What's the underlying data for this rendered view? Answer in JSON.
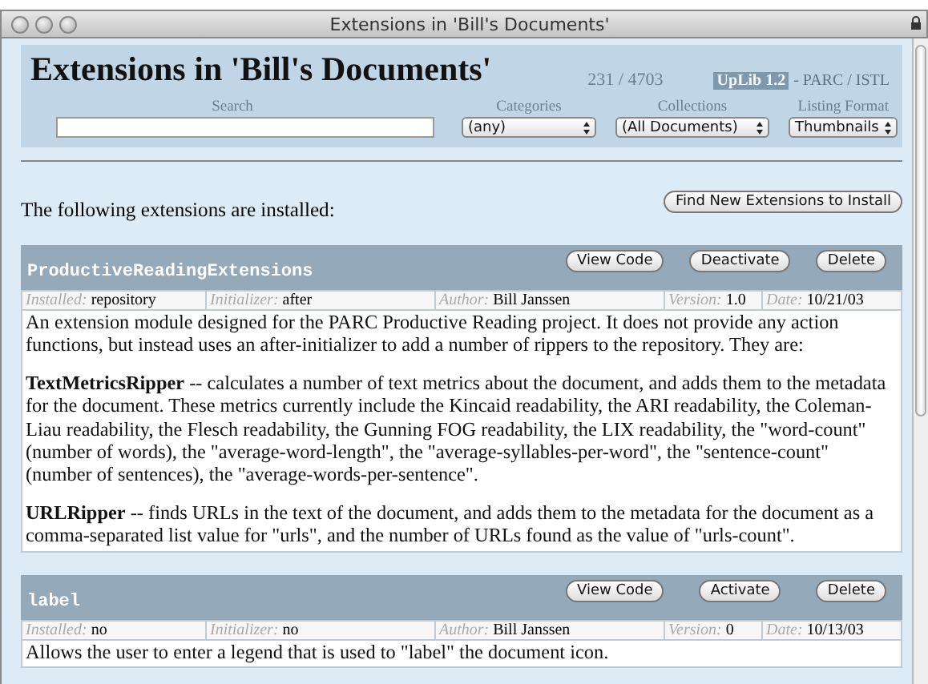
{
  "window": {
    "title": "Extensions in 'Bill's Documents'"
  },
  "header": {
    "title": "Extensions in 'Bill's Documents'",
    "count": "231 / 4703",
    "brand": "UpLib 1.2",
    "brand_suffix": "- PARC / ISTL",
    "search": {
      "label": "Search"
    },
    "dropdowns": [
      {
        "label": "Categories",
        "value": "(any)"
      },
      {
        "label": "Collections",
        "value": "(All Documents)"
      },
      {
        "label": "Listing Format",
        "value": "Thumbnails"
      }
    ]
  },
  "intro": "The following extensions are installed:",
  "find_button": "Find New Extensions to Install",
  "extensions": [
    {
      "name": "ProductiveReadingExtensions",
      "buttons": [
        "View Code",
        "Deactivate",
        "Delete"
      ],
      "meta": [
        {
          "label": "Installed:",
          "value": "repository"
        },
        {
          "label": "Initializer:",
          "value": "after"
        },
        {
          "label": "Author:",
          "value": "Bill Janssen"
        },
        {
          "label": "Version:",
          "value": "1.0"
        },
        {
          "label": "Date:",
          "value": "10/21/03"
        }
      ],
      "paragraphs": [
        "An extension module designed for the PARC Productive Reading project. It does not provide any action functions, but instead uses an after-initializer to add a number of rippers to the repository. They are:",
        "**TextMetricsRipper** -- calculates a number of text metrics about the document, and adds them to the metadata for the document. These metrics currently include the Kincaid readability, the ARI readability, the Coleman-Liau readability, the Flesch readability, the Gunning FOG readability, the LIX readability, the \"word-count\" (number of words), the \"average-word-length\", the \"average-syllables-per-word\", the \"sentence-count\" (number of sentences), the \"average-words-per-sentence\".",
        "**URLRipper** -- finds URLs in the text of the document, and adds them to the metadata for the document as a comma-separated list value for \"urls\", and the number of URLs found as the value of \"urls-count\"."
      ]
    },
    {
      "name": "label",
      "buttons": [
        "View Code",
        "Activate",
        "Delete"
      ],
      "meta": [
        {
          "label": "Installed:",
          "value": "no"
        },
        {
          "label": "Initializer:",
          "value": "no"
        },
        {
          "label": "Author:",
          "value": "Bill Janssen"
        },
        {
          "label": "Version:",
          "value": "0"
        },
        {
          "label": "Date:",
          "value": "10/13/03"
        }
      ],
      "paragraphs": [
        "Allows the user to enter a legend that is used to \"label\" the document icon."
      ]
    }
  ]
}
